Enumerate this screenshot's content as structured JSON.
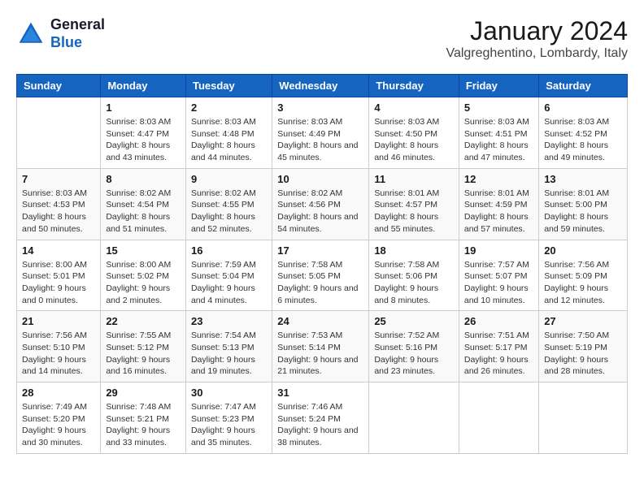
{
  "logo": {
    "line1": "General",
    "line2": "Blue"
  },
  "title": "January 2024",
  "subtitle": "Valgreghentino, Lombardy, Italy",
  "days_of_week": [
    "Sunday",
    "Monday",
    "Tuesday",
    "Wednesday",
    "Thursday",
    "Friday",
    "Saturday"
  ],
  "weeks": [
    [
      {
        "num": "",
        "sunrise": "",
        "sunset": "",
        "daylight": ""
      },
      {
        "num": "1",
        "sunrise": "Sunrise: 8:03 AM",
        "sunset": "Sunset: 4:47 PM",
        "daylight": "Daylight: 8 hours and 43 minutes."
      },
      {
        "num": "2",
        "sunrise": "Sunrise: 8:03 AM",
        "sunset": "Sunset: 4:48 PM",
        "daylight": "Daylight: 8 hours and 44 minutes."
      },
      {
        "num": "3",
        "sunrise": "Sunrise: 8:03 AM",
        "sunset": "Sunset: 4:49 PM",
        "daylight": "Daylight: 8 hours and 45 minutes."
      },
      {
        "num": "4",
        "sunrise": "Sunrise: 8:03 AM",
        "sunset": "Sunset: 4:50 PM",
        "daylight": "Daylight: 8 hours and 46 minutes."
      },
      {
        "num": "5",
        "sunrise": "Sunrise: 8:03 AM",
        "sunset": "Sunset: 4:51 PM",
        "daylight": "Daylight: 8 hours and 47 minutes."
      },
      {
        "num": "6",
        "sunrise": "Sunrise: 8:03 AM",
        "sunset": "Sunset: 4:52 PM",
        "daylight": "Daylight: 8 hours and 49 minutes."
      }
    ],
    [
      {
        "num": "7",
        "sunrise": "Sunrise: 8:03 AM",
        "sunset": "Sunset: 4:53 PM",
        "daylight": "Daylight: 8 hours and 50 minutes."
      },
      {
        "num": "8",
        "sunrise": "Sunrise: 8:02 AM",
        "sunset": "Sunset: 4:54 PM",
        "daylight": "Daylight: 8 hours and 51 minutes."
      },
      {
        "num": "9",
        "sunrise": "Sunrise: 8:02 AM",
        "sunset": "Sunset: 4:55 PM",
        "daylight": "Daylight: 8 hours and 52 minutes."
      },
      {
        "num": "10",
        "sunrise": "Sunrise: 8:02 AM",
        "sunset": "Sunset: 4:56 PM",
        "daylight": "Daylight: 8 hours and 54 minutes."
      },
      {
        "num": "11",
        "sunrise": "Sunrise: 8:01 AM",
        "sunset": "Sunset: 4:57 PM",
        "daylight": "Daylight: 8 hours and 55 minutes."
      },
      {
        "num": "12",
        "sunrise": "Sunrise: 8:01 AM",
        "sunset": "Sunset: 4:59 PM",
        "daylight": "Daylight: 8 hours and 57 minutes."
      },
      {
        "num": "13",
        "sunrise": "Sunrise: 8:01 AM",
        "sunset": "Sunset: 5:00 PM",
        "daylight": "Daylight: 8 hours and 59 minutes."
      }
    ],
    [
      {
        "num": "14",
        "sunrise": "Sunrise: 8:00 AM",
        "sunset": "Sunset: 5:01 PM",
        "daylight": "Daylight: 9 hours and 0 minutes."
      },
      {
        "num": "15",
        "sunrise": "Sunrise: 8:00 AM",
        "sunset": "Sunset: 5:02 PM",
        "daylight": "Daylight: 9 hours and 2 minutes."
      },
      {
        "num": "16",
        "sunrise": "Sunrise: 7:59 AM",
        "sunset": "Sunset: 5:04 PM",
        "daylight": "Daylight: 9 hours and 4 minutes."
      },
      {
        "num": "17",
        "sunrise": "Sunrise: 7:58 AM",
        "sunset": "Sunset: 5:05 PM",
        "daylight": "Daylight: 9 hours and 6 minutes."
      },
      {
        "num": "18",
        "sunrise": "Sunrise: 7:58 AM",
        "sunset": "Sunset: 5:06 PM",
        "daylight": "Daylight: 9 hours and 8 minutes."
      },
      {
        "num": "19",
        "sunrise": "Sunrise: 7:57 AM",
        "sunset": "Sunset: 5:07 PM",
        "daylight": "Daylight: 9 hours and 10 minutes."
      },
      {
        "num": "20",
        "sunrise": "Sunrise: 7:56 AM",
        "sunset": "Sunset: 5:09 PM",
        "daylight": "Daylight: 9 hours and 12 minutes."
      }
    ],
    [
      {
        "num": "21",
        "sunrise": "Sunrise: 7:56 AM",
        "sunset": "Sunset: 5:10 PM",
        "daylight": "Daylight: 9 hours and 14 minutes."
      },
      {
        "num": "22",
        "sunrise": "Sunrise: 7:55 AM",
        "sunset": "Sunset: 5:12 PM",
        "daylight": "Daylight: 9 hours and 16 minutes."
      },
      {
        "num": "23",
        "sunrise": "Sunrise: 7:54 AM",
        "sunset": "Sunset: 5:13 PM",
        "daylight": "Daylight: 9 hours and 19 minutes."
      },
      {
        "num": "24",
        "sunrise": "Sunrise: 7:53 AM",
        "sunset": "Sunset: 5:14 PM",
        "daylight": "Daylight: 9 hours and 21 minutes."
      },
      {
        "num": "25",
        "sunrise": "Sunrise: 7:52 AM",
        "sunset": "Sunset: 5:16 PM",
        "daylight": "Daylight: 9 hours and 23 minutes."
      },
      {
        "num": "26",
        "sunrise": "Sunrise: 7:51 AM",
        "sunset": "Sunset: 5:17 PM",
        "daylight": "Daylight: 9 hours and 26 minutes."
      },
      {
        "num": "27",
        "sunrise": "Sunrise: 7:50 AM",
        "sunset": "Sunset: 5:19 PM",
        "daylight": "Daylight: 9 hours and 28 minutes."
      }
    ],
    [
      {
        "num": "28",
        "sunrise": "Sunrise: 7:49 AM",
        "sunset": "Sunset: 5:20 PM",
        "daylight": "Daylight: 9 hours and 30 minutes."
      },
      {
        "num": "29",
        "sunrise": "Sunrise: 7:48 AM",
        "sunset": "Sunset: 5:21 PM",
        "daylight": "Daylight: 9 hours and 33 minutes."
      },
      {
        "num": "30",
        "sunrise": "Sunrise: 7:47 AM",
        "sunset": "Sunset: 5:23 PM",
        "daylight": "Daylight: 9 hours and 35 minutes."
      },
      {
        "num": "31",
        "sunrise": "Sunrise: 7:46 AM",
        "sunset": "Sunset: 5:24 PM",
        "daylight": "Daylight: 9 hours and 38 minutes."
      },
      {
        "num": "",
        "sunrise": "",
        "sunset": "",
        "daylight": ""
      },
      {
        "num": "",
        "sunrise": "",
        "sunset": "",
        "daylight": ""
      },
      {
        "num": "",
        "sunrise": "",
        "sunset": "",
        "daylight": ""
      }
    ]
  ]
}
